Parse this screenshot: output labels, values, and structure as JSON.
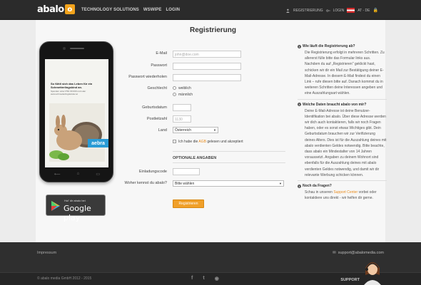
{
  "header": {
    "logo_text": "abalo",
    "logo_badge": "o",
    "nav": [
      "TECHNOLOGY SOLUTIONS",
      "WSWIPE",
      "LOGIN"
    ],
    "right": {
      "register": "REGISTRIERUNG",
      "login": "LOGIN",
      "locale": "AT - DE"
    }
  },
  "page": {
    "title": "Registrierung"
  },
  "promo": {
    "ad_headline": "So fühlt sich das Leben für ein Schmetterlingskind an.",
    "ad_small": "Spenden unter PSK 60.000 und oder www.schmetterlingskinder.at",
    "brand": "aebra",
    "gplay_small": "Hol' dir abalo bei",
    "gplay_big": "Google play"
  },
  "form": {
    "email_label": "E-Mail",
    "email_placeholder": "john@doe.com",
    "password_label": "Passwort",
    "password_repeat_label": "Passwort wiederholen",
    "gender_label": "Geschlecht",
    "gender_female": "weiblich",
    "gender_male": "männlich",
    "birthdate_label": "Geburtsdatum",
    "zip_label": "Postleitzahl",
    "zip_placeholder": "1130",
    "country_label": "Land",
    "country_value": "Österreich",
    "agb_pre": "Ich habe die",
    "agb_link": "AGB",
    "agb_post": "gelesen und akzeptiert",
    "optional_title": "OPTIONALE ANGABEN",
    "invite_label": "Einladungscode",
    "source_label": "Woher kennst du abalo?",
    "source_value": "Bitte wählen",
    "submit": "Registrieren"
  },
  "sidebar": {
    "q1": "Wie läuft die Registrierung ab?",
    "a1": "Die Registrierung erfolgt in mehreren Schritten. Zu allererst fülle bitte das Formular links aus. Nachdem du auf „Registrieren\" geklickt hast, schicken wir dir ein Mail zur Bestätigung deiner E-Mail-Adresse. In diesem E-Mail findest du einen Link – rufe diesen bitte auf. Danach kommst du in weiteren Schritten deine Interessen angeben und eine Auszahlungsart wählen.",
    "q2": "Welche Daten braucht abalo von mir?",
    "a2": "Deine E-Mail-Adresse ist deine Benutzer-Identifikation bei abalo. Über diese Adresse werden wir dich auch kontaktieren, falls wir noch Fragen haben, oder es sonst etwas Wichtiges gibt. Dein Geburtsdatum brauchen wir zur Verifizierung deines Alters. Dies ist für die Auszahlung deines mit abalo verdienten Geldes notwendig. Bitte beachte, dass abalo ein Mindestalter von 14 Jahren voraussetzt. Angaben zu deinem Wohnort sind ebenfalls für die Auszahlung deines mit abalo verdienten Geldes notwendig, und damit wir dir relevante Werbung schicken können.",
    "q3": "Noch da Fragen?",
    "a3_pre": "Schau in unseren",
    "a3_link": "Support Center",
    "a3_post": "vorbei oder kontaktiere uns direkt - wir helfen dir gerne."
  },
  "footer": {
    "impressum": "Impressum",
    "email": "support@abalomedia.com",
    "copyright": "© abalo media GmbH 2012 - 2015",
    "support": "SUPPORT",
    "socials": [
      "facebook-icon",
      "twitter-icon",
      "android-icon"
    ]
  },
  "colors": {
    "accent": "#f0a02a",
    "dark": "#2b2b2b",
    "brand_blue": "#2a9bd5"
  }
}
